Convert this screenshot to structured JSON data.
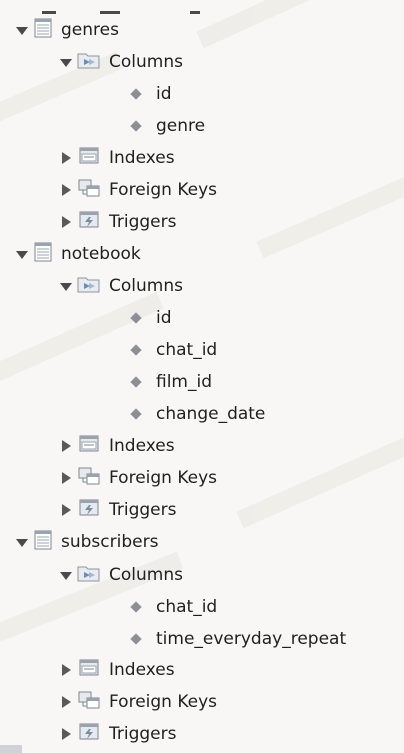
{
  "tree": {
    "tables": [
      {
        "name": "genres",
        "columns_label": "Columns",
        "columns": [
          "id",
          "genre"
        ],
        "indexes_label": "Indexes",
        "foreign_keys_label": "Foreign Keys",
        "triggers_label": "Triggers"
      },
      {
        "name": "notebook",
        "columns_label": "Columns",
        "columns": [
          "id",
          "chat_id",
          "film_id",
          "change_date"
        ],
        "indexes_label": "Indexes",
        "foreign_keys_label": "Foreign Keys",
        "triggers_label": "Triggers"
      },
      {
        "name": "subscribers",
        "columns_label": "Columns",
        "columns": [
          "chat_id",
          "time_everyday_repeat"
        ],
        "indexes_label": "Indexes",
        "foreign_keys_label": "Foreign Keys",
        "triggers_label": "Triggers"
      }
    ]
  },
  "icons": {
    "table": "table-icon",
    "columns": "columns-folder-icon",
    "column": "column-diamond-icon",
    "indexes": "indexes-icon",
    "foreign_keys": "foreign-keys-icon",
    "triggers": "triggers-icon"
  },
  "colors": {
    "background": "#f8f7f5",
    "text": "#1f1f1f",
    "diamond": "#8c8f96",
    "arrow": "#4a4a4a"
  }
}
